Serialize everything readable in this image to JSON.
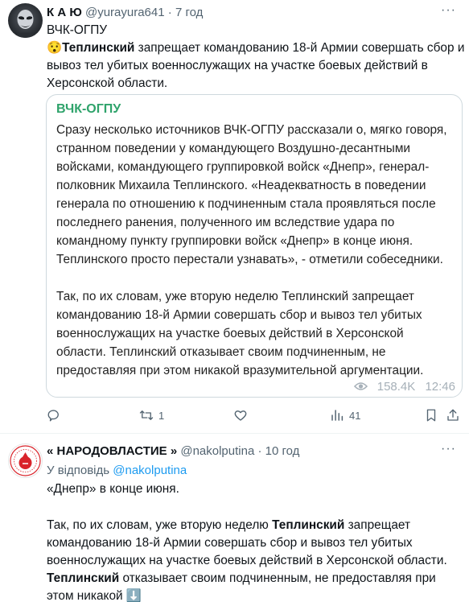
{
  "tweet1": {
    "avatar": "masked-figure-avatar",
    "display_name": "К А Ю",
    "handle": "@yurayura641",
    "separator": "·",
    "time": "7 год",
    "more": "···",
    "channel": "ВЧК-ОГПУ",
    "emoji": "😯",
    "bold_name": "Теплинский",
    "text": " запрещает командованию 18-й Армии совершать сбор и вывоз тел убитых военнослужащих на участке боевых действий в Херсонской области.",
    "card": {
      "title": "ВЧК-ОГПУ",
      "paragraph1": "Сразу несколько источников ВЧК-ОГПУ рассказали о, мягко говоря, странном поведении у командующего Воздушно-десантными войсками, командующего группировкой войск «Днепр», генерал-полковник Михаила Теплинского. «Неадекватность в поведении генерала по отношению к подчиненным стала проявляться после последнего ранения, полученного им вследствие удара по командному пункту группировки войск «Днепр» в конце июня. Теплинского просто перестали узнавать», - отметили собеседники.",
      "paragraph2": " Так, по их словам, уже вторую неделю Теплинский запрещает командованию 18-й Армии совершать сбор и вывоз тел убитых военнослужащих на участке боевых действий в Херсонской области. Теплинский отказывает своим подчиненным, не предоставляя при этом никакой вразумительной аргументации.",
      "views": "158.4K",
      "time": "12:46"
    },
    "actions": {
      "replies": "",
      "retweets": "1",
      "likes": "",
      "views": "41"
    }
  },
  "tweet2": {
    "avatar": "narodovlastie-logo",
    "display_name": "« НАРОДОВЛАСТИЕ »",
    "handle": "@nakolputina",
    "separator": "·",
    "time": "10 год",
    "more": "···",
    "reply_prefix": "У відповідь",
    "reply_handle": "@nakolputina",
    "line1": "«Днепр» в конце июня.",
    "p2_a": "Так, по их словам, уже вторую неделю ",
    "p2_b": "Теплинский",
    "p2_c": " запрещает командованию 18-й Армии совершать сбор и вывоз тел убитых военнослужащих на участке боевых действий в Херсонской области.",
    "p3_a": "Теплинский",
    "p3_b": " отказывает своим подчиненным, не предоставляя при этом никакой ",
    "emoji": "⬇️"
  },
  "colors": {
    "card_title": "#2fa36b",
    "link": "#1d9bf0",
    "meta": "#536471",
    "border": "#cfd9de"
  }
}
